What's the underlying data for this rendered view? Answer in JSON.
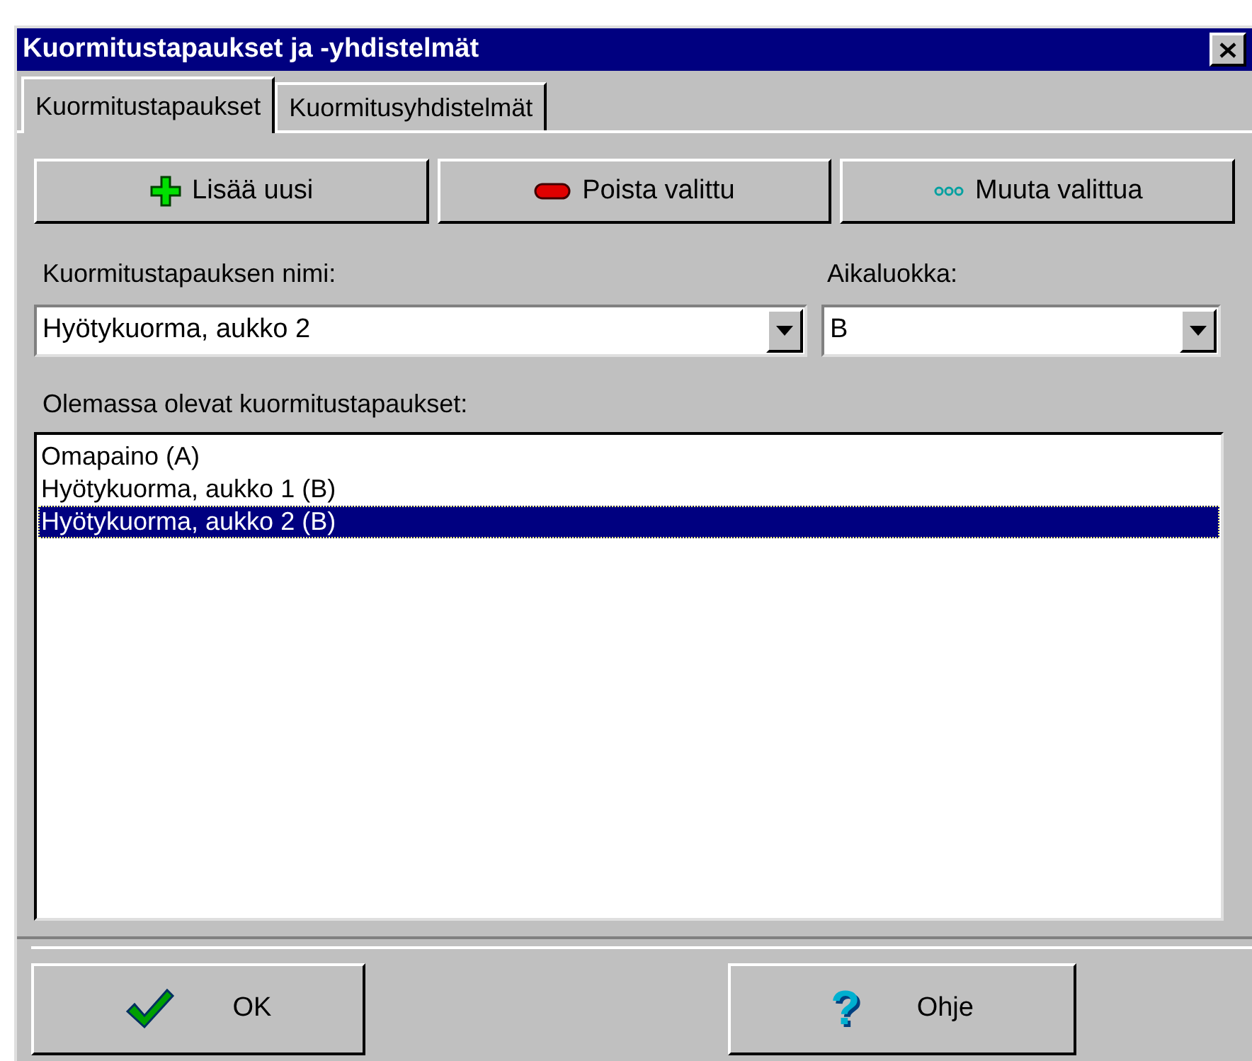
{
  "window": {
    "title": "Kuormitustapaukset ja -yhdistelmät"
  },
  "tabs": [
    {
      "label": "Kuormitustapaukset",
      "selected": true
    },
    {
      "label": "Kuormitusyhdistelmät",
      "selected": false
    }
  ],
  "actions": [
    {
      "kind": "add",
      "label": "Lisää uusi"
    },
    {
      "kind": "remove",
      "label": "Poista valittu"
    },
    {
      "kind": "edit",
      "label": "Muuta valittua"
    }
  ],
  "name_field": {
    "label": "Kuormitustapauksen nimi:",
    "value": "Hyötykuorma, aukko 2"
  },
  "class_field": {
    "label": "Aikaluokka:",
    "value": "B"
  },
  "list": {
    "label": "Olemassa olevat kuormitustapaukset:",
    "items": [
      {
        "text": "Omapaino (A)",
        "selected": false
      },
      {
        "text": "Hyötykuorma, aukko 1 (B)",
        "selected": false
      },
      {
        "text": "Hyötykuorma, aukko 2 (B)",
        "selected": true
      }
    ]
  },
  "footer": {
    "ok": {
      "label": "OK"
    },
    "help": {
      "label": "Ohje",
      "icon": "?"
    }
  }
}
